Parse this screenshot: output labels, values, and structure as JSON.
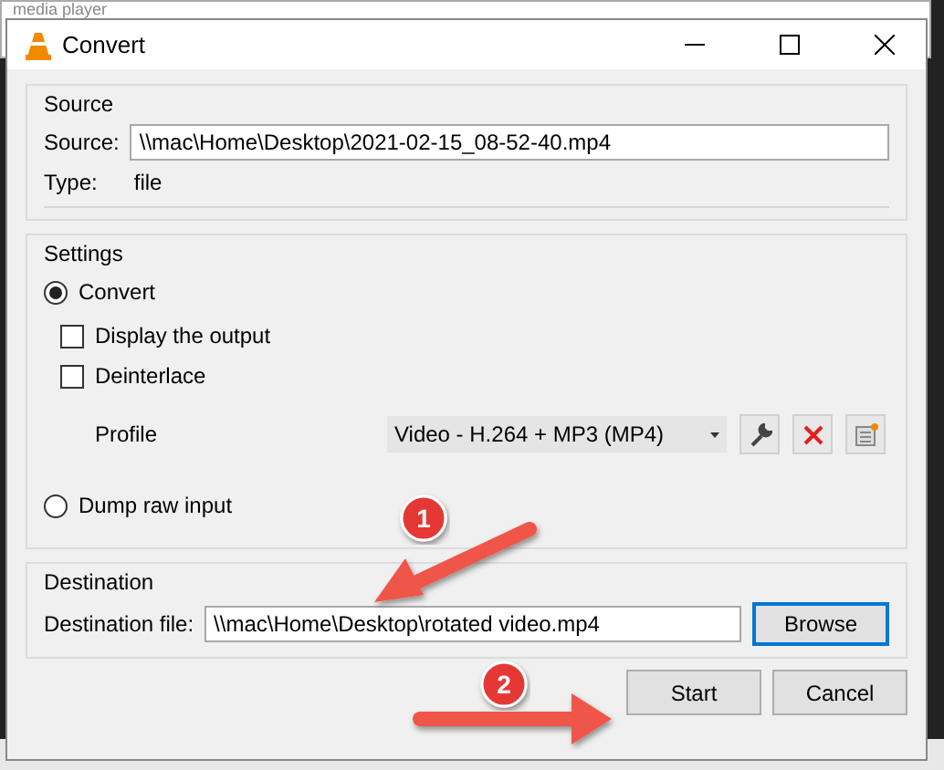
{
  "background_window": {
    "title": "media player"
  },
  "window": {
    "title": "Convert"
  },
  "source": {
    "title": "Source",
    "label": "Source:",
    "value": "\\\\mac\\Home\\Desktop\\2021-02-15_08-52-40.mp4",
    "type_label": "Type:",
    "type_value": "file"
  },
  "settings": {
    "title": "Settings",
    "items": [
      {
        "kind": "radio",
        "label": "Convert",
        "selected": true
      },
      {
        "kind": "checkbox",
        "label": "Display the output",
        "checked": false
      },
      {
        "kind": "checkbox",
        "label": "Deinterlace",
        "checked": false
      },
      {
        "kind": "profile",
        "label": "Profile",
        "value": "Video - H.264 + MP3 (MP4)"
      },
      {
        "kind": "radio",
        "label": "Dump raw input",
        "selected": false
      }
    ]
  },
  "destination": {
    "title": "Destination",
    "label": "Destination file:",
    "value": "\\\\mac\\Home\\Desktop\\rotated video.mp4",
    "browse": {
      "label": "Browse",
      "focused": true
    }
  },
  "buttons": [
    {
      "label": "Start"
    },
    {
      "label": "Cancel"
    }
  ],
  "annotations": [
    {
      "number": "1"
    },
    {
      "number": "2"
    }
  ]
}
